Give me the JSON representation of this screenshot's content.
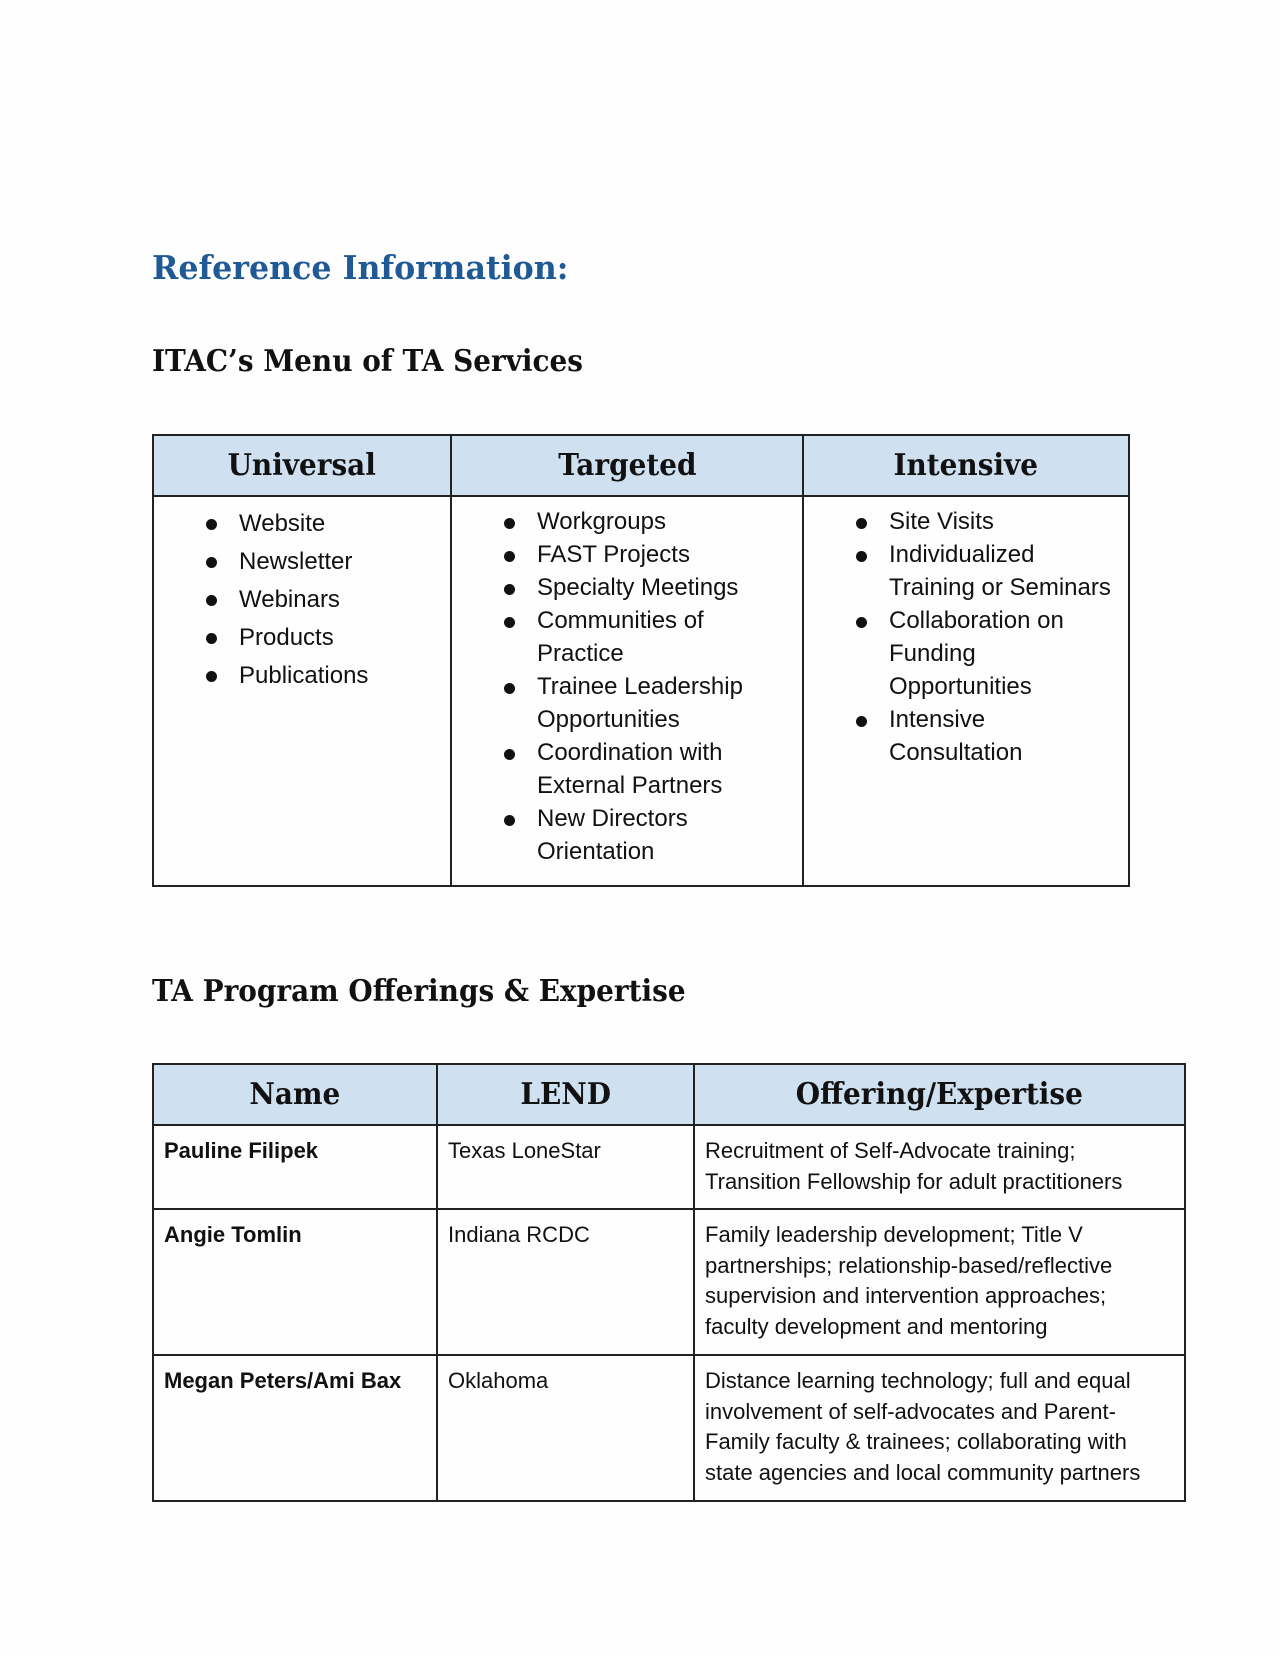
{
  "document": {
    "title": "Reference Information:",
    "title_color": "#1f5a96",
    "header_fill_color": "#cfe0f1"
  },
  "menu_section": {
    "heading": "ITAC’s Menu of TA Services",
    "columns": [
      {
        "header": "Universal",
        "items": [
          "Website",
          "Newsletter",
          "Webinars",
          "Products",
          "Publications"
        ]
      },
      {
        "header": "Targeted",
        "items": [
          "Workgroups",
          "FAST Projects",
          "Specialty Meetings",
          "Communities of Practice",
          "Trainee Leadership Opportunities",
          "Coordination with External Partners",
          "New Directors Orientation"
        ]
      },
      {
        "header": "Intensive",
        "items": [
          "Site Visits",
          "Individualized Training or Seminars",
          "Collaboration on Funding Opportunities",
          "Intensive Consultation"
        ]
      }
    ]
  },
  "program_section": {
    "heading": "TA Program Offerings & Expertise",
    "columns": [
      "Name",
      "LEND",
      "Offering/Expertise"
    ],
    "rows": [
      {
        "name": "Pauline Filipek",
        "lend": "Texas LoneStar",
        "offering": "Recruitment of Self-Advocate training; Transition Fellowship for adult practitioners"
      },
      {
        "name": "Angie Tomlin",
        "lend": "Indiana RCDC",
        "offering": "Family leadership development; Title V partnerships; relationship-based/reflective supervision and intervention approaches; faculty development and mentoring"
      },
      {
        "name": "Megan Peters/Ami Bax",
        "lend": "Oklahoma",
        "offering": "Distance learning technology; full and equal involvement of self-advocates and Parent-Family faculty & trainees; collaborating with state agencies and local community partners"
      }
    ]
  }
}
